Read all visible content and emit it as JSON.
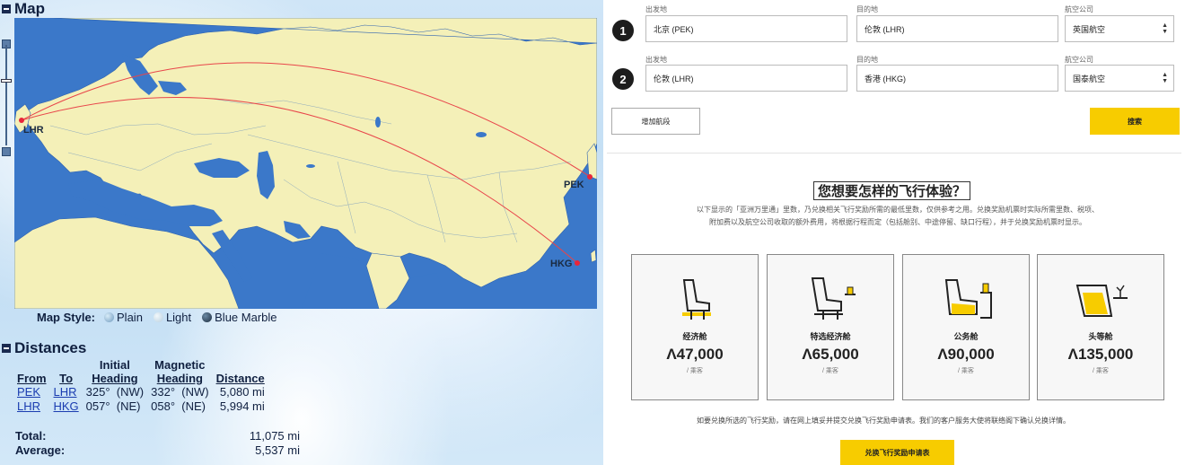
{
  "left": {
    "map_heading": "Map",
    "airports": {
      "lhr": "LHR",
      "pek": "PEK",
      "hkg": "HKG"
    },
    "map_style": {
      "label": "Map Style:",
      "options": [
        "Plain",
        "Light",
        "Blue Marble"
      ]
    },
    "distances_heading": "Distances",
    "table": {
      "headers": {
        "from": "From",
        "to": "To",
        "initial_1": "Initial",
        "initial_2": "Heading",
        "magnetic_1": "Magnetic",
        "magnetic_2": "Heading",
        "distance": "Distance"
      },
      "rows": [
        {
          "from": "PEK",
          "to": "LHR",
          "initial": "325°",
          "initial_dir": "(NW)",
          "magnetic": "332°",
          "magnetic_dir": "(NW)",
          "distance": "5,080 mi"
        },
        {
          "from": "LHR",
          "to": "HKG",
          "initial": "057°",
          "initial_dir": "(NE)",
          "magnetic": "058°",
          "magnetic_dir": "(NE)",
          "distance": "5,994 mi"
        }
      ],
      "total_label": "Total:",
      "total_value": "11,075 mi",
      "average_label": "Average:",
      "average_value": "5,537 mi"
    },
    "colors": {
      "ocean": "#3b78c9",
      "land": "#f4f0b8",
      "route": "#e8454a"
    }
  },
  "right": {
    "segments": [
      {
        "num": "1",
        "from_label": "出发地",
        "from_value": "北京 (PEK)",
        "to_label": "目的地",
        "to_value": "伦敦 (LHR)",
        "airline_label": "航空公司",
        "airline_value": "英国航空"
      },
      {
        "num": "2",
        "from_label": "出发地",
        "from_value": "伦敦 (LHR)",
        "to_label": "目的地",
        "to_value": "香港 (HKG)",
        "airline_label": "航空公司",
        "airline_value": "国泰航空"
      }
    ],
    "add_segment": "增加航段",
    "search": "搜索",
    "title": "您想要怎样的飞行体验？",
    "desc_1": "以下显示的「亚洲万里通」里数，乃兑换相关飞行奖励所需的最低里数，仅供参考之用。兑换奖励机票时实际所需里数、税项、",
    "desc_2": "附加费以及航空公司收取的额外费用，将根据行程而定（包括舱别、中途停留、缺口行程），并于兑换奖励机票时显示。",
    "cabins": [
      {
        "name": "经济舱",
        "price": "47,000",
        "unit": "/ 乘客"
      },
      {
        "name": "特选经济舱",
        "price": "65,000",
        "unit": "/ 乘客"
      },
      {
        "name": "公务舱",
        "price": "90,000",
        "unit": "/ 乘客"
      },
      {
        "name": "头等舱",
        "price": "135,000",
        "unit": "/ 乘客"
      }
    ],
    "bottom_note": "如要兑换所选的飞行奖励，请在网上填妥并提交兑换飞行奖励申请表。我们的客户服务大使将联络阁下确认兑换详情。",
    "apply_button": "兑换飞行奖励申请表",
    "colors": {
      "accent": "#f7cc00"
    }
  }
}
